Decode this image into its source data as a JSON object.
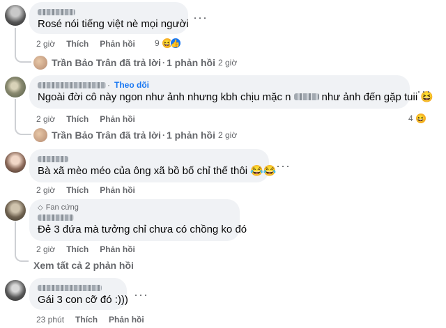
{
  "comments": [
    {
      "text": "Rosé nói tiếng việt nè mọi người",
      "time": "2 giờ",
      "like": "Thích",
      "reply": "Phản hồi",
      "reaction_count": "9",
      "reply_summary": {
        "name": "Trần Bảo Trân đã trả lời",
        "sep": "·",
        "count": "1 phản hồi",
        "time": "2 giờ"
      }
    },
    {
      "follow": "Theo dõi",
      "text": "Ngoài đời cô này ngon như ảnh nhưng kbh chịu mặc n",
      "text_tail": "như ảnh đến gặp tuii 😆",
      "time": "2 giờ",
      "like": "Thích",
      "reply": "Phản hồi",
      "reaction_count": "4",
      "reply_summary": {
        "name": "Trần Bảo Trân đã trả lời",
        "sep": "·",
        "count": "1 phản hồi",
        "time": "2 giờ"
      }
    },
    {
      "text": "Bà xã mèo méo của ông xã bồ bố chỉ thế thôi 😂😂",
      "time": "2 giờ",
      "like": "Thích",
      "reply": "Phản hồi"
    },
    {
      "badge": "Fan cứng",
      "text": "Đẻ 3 đứa mà tưởng chỉ chưa có chồng ko đó",
      "time": "2 giờ",
      "like": "Thích",
      "reply": "Phản hồi",
      "see_all": "Xem tất cả 2 phản hồi"
    },
    {
      "text": "Gái 3 con cỡ đó :)))",
      "time": "23 phút",
      "like": "Thích",
      "reply": "Phản hồi"
    }
  ],
  "more_glyph": "···",
  "colors": {
    "link": "#1877f2",
    "bubble": "#f0f2f5",
    "meta": "#65676b"
  }
}
